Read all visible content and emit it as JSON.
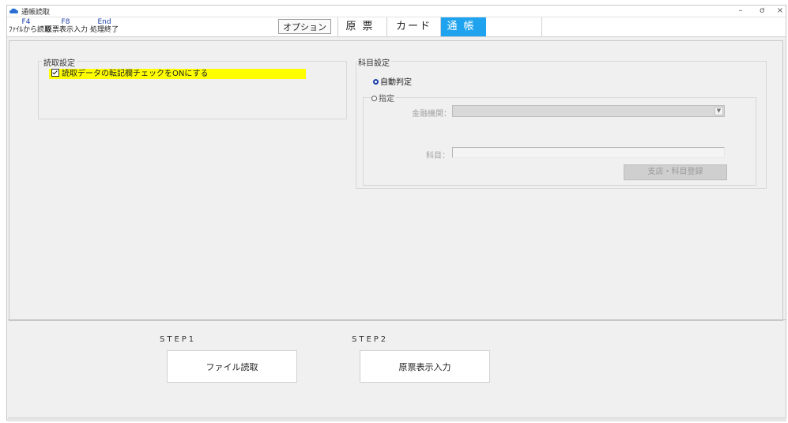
{
  "window": {
    "title": "通帳読取",
    "controls": {
      "minimize": "–",
      "maximize": "ơ",
      "close": "×"
    }
  },
  "toolbar": {
    "fkeys": [
      {
        "key": "F4",
        "label": "ﾌｧｲﾙから読取"
      },
      {
        "key": "F8",
        "label": "原票表示入力"
      },
      {
        "key": "End",
        "label": "処理終了"
      }
    ],
    "option_label": "オプション",
    "tabs": [
      {
        "label": "原票"
      },
      {
        "label": "カード"
      },
      {
        "label": "通帳",
        "active": true
      }
    ]
  },
  "read_settings": {
    "title": "読取設定",
    "checkbox_label": "読取データの転記欄チェックをONにする",
    "checked": true
  },
  "subject_settings": {
    "title": "科目設定",
    "auto_label": "自動判定",
    "specify_label": "指定",
    "bank_label": "金融機関：",
    "subject_label": "科目：",
    "register_label": "支店・科目登録"
  },
  "steps": {
    "step1": "STEP1",
    "step2": "STEP2",
    "file_read": "ファイル読取",
    "slip_input": "原票表示入力"
  },
  "colors": {
    "active_tab": "#1fa3ef",
    "highlight": "#ffff00",
    "fkey": "#1c3fa8"
  }
}
